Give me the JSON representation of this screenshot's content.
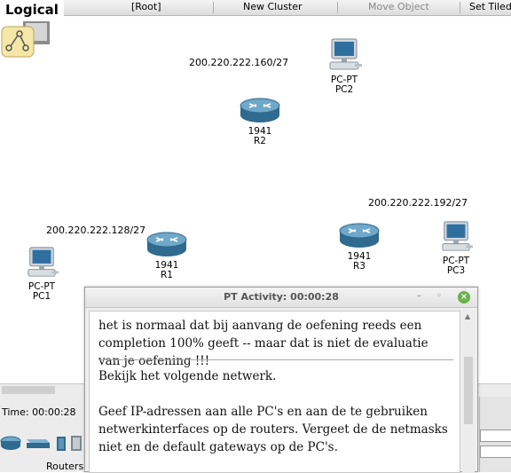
{
  "toolbar": {
    "mode": "Logical",
    "root": "[Root]",
    "new_cluster": "New Cluster",
    "move_object": "Move Object",
    "set_tiled": "Set Tiled"
  },
  "networks": {
    "n2": "200.220.222.160/27",
    "n1": "200.220.222.128/27",
    "n3": "200.220.222.192/27"
  },
  "devices": {
    "pc2": {
      "type": "PC-PT",
      "name": "PC2"
    },
    "r2": {
      "type": "1941",
      "name": "R2"
    },
    "r1": {
      "type": "1941",
      "name": "R1"
    },
    "r3": {
      "type": "1941",
      "name": "R3"
    },
    "pc1": {
      "type": "PC-PT",
      "name": "PC1"
    },
    "pc3": {
      "type": "PC-PT",
      "name": "PC3"
    }
  },
  "bottom": {
    "time": "Time: 00:00:28",
    "category": "Routers"
  },
  "dialog": {
    "title": "PT Activity: 00:00:28",
    "close": "×",
    "para1": "het is normaal dat bij aanvang de oefening reeds een completion 100% geeft -- maar dat is niet de evaluatie van je oefening !!!",
    "para2": "Bekijk het volgende netwerk.",
    "para3": "Geef IP-adressen aan alle PC's en aan de te gebruiken netwerkinterfaces op de routers. Vergeet de de netmasks niet en de default gateways op de PC's."
  },
  "colors": {
    "router_body": "#3d7fa6",
    "pc_screen": "#2f6fa0",
    "close_green": "#6ab04c"
  }
}
